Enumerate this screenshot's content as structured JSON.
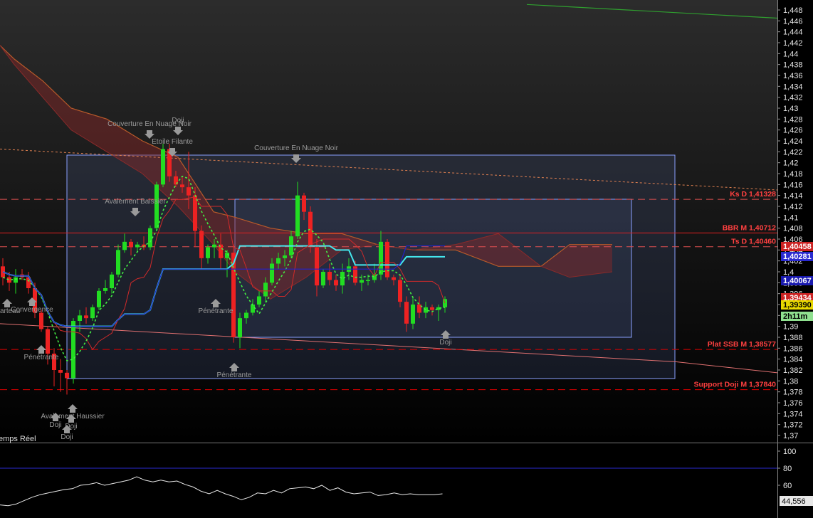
{
  "chart_data": [
    {
      "type": "candlestick",
      "title": "",
      "ylim": [
        1.369,
        1.449
      ],
      "y_ticks": [
        "1,448",
        "1,446",
        "1,444",
        "1,442",
        "1,44",
        "1,438",
        "1,436",
        "1,434",
        "1,432",
        "1,43",
        "1,428",
        "1,426",
        "1,424",
        "1,422",
        "1,42",
        "1,418",
        "1,416",
        "1,414",
        "1,412",
        "1,41",
        "1,408",
        "1,406",
        "1,404",
        "1,402",
        "1,4",
        "1,398",
        "1,396",
        "1,394",
        "1,392",
        "1,39",
        "1,388",
        "1,386",
        "1,384",
        "1,382",
        "1,38",
        "1,378",
        "1,376",
        "1,374",
        "1,372",
        "1,37"
      ],
      "y_tick_values": [
        1.448,
        1.446,
        1.444,
        1.442,
        1.44,
        1.438,
        1.436,
        1.434,
        1.432,
        1.43,
        1.428,
        1.426,
        1.424,
        1.422,
        1.42,
        1.418,
        1.416,
        1.414,
        1.412,
        1.41,
        1.408,
        1.406,
        1.404,
        1.402,
        1.4,
        1.398,
        1.396,
        1.394,
        1.392,
        1.39,
        1.388,
        1.386,
        1.384,
        1.382,
        1.38,
        1.378,
        1.376,
        1.374,
        1.372,
        1.37
      ],
      "candles": [
        [
          1.401,
          1.4025,
          1.3975,
          1.399
        ],
        [
          1.399,
          1.4,
          1.3965,
          1.398
        ],
        [
          1.398,
          1.4005,
          1.396,
          1.399
        ],
        [
          1.3995,
          1.4005,
          1.3985,
          1.399
        ],
        [
          1.399,
          1.4,
          1.396,
          1.397
        ],
        [
          1.397,
          1.398,
          1.3915,
          1.3925
        ],
        [
          1.3925,
          1.393,
          1.389,
          1.3895
        ],
        [
          1.3895,
          1.39,
          1.383,
          1.385
        ],
        [
          1.385,
          1.386,
          1.379,
          1.382
        ],
        [
          1.382,
          1.384,
          1.378,
          1.3815
        ],
        [
          1.3815,
          1.382,
          1.3775,
          1.3805
        ],
        [
          1.3805,
          1.3915,
          1.3795,
          1.391
        ],
        [
          1.391,
          1.393,
          1.389,
          1.392
        ],
        [
          1.392,
          1.3935,
          1.3905,
          1.3915
        ],
        [
          1.3915,
          1.394,
          1.391,
          1.3935
        ],
        [
          1.3935,
          1.397,
          1.393,
          1.3965
        ],
        [
          1.3965,
          1.3985,
          1.396,
          1.397
        ],
        [
          1.397,
          1.4,
          1.396,
          1.3995
        ],
        [
          1.3995,
          1.405,
          1.399,
          1.404
        ],
        [
          1.404,
          1.407,
          1.4035,
          1.4055
        ],
        [
          1.4055,
          1.406,
          1.403,
          1.4045
        ],
        [
          1.4045,
          1.4055,
          1.4035,
          1.405
        ],
        [
          1.405,
          1.4065,
          1.404,
          1.4045
        ],
        [
          1.4045,
          1.4085,
          1.404,
          1.408
        ],
        [
          1.408,
          1.4165,
          1.4075,
          1.416
        ],
        [
          1.416,
          1.4235,
          1.4155,
          1.4225
        ],
        [
          1.4225,
          1.4235,
          1.4165,
          1.4175
        ],
        [
          1.4175,
          1.4185,
          1.4155,
          1.416
        ],
        [
          1.416,
          1.4175,
          1.4145,
          1.4155
        ],
        [
          1.4155,
          1.422,
          1.4115,
          1.414
        ],
        [
          1.414,
          1.4155,
          1.4045,
          1.4075
        ],
        [
          1.4075,
          1.4085,
          1.4005,
          1.4025
        ],
        [
          1.4025,
          1.405,
          1.4015,
          1.4045
        ],
        [
          1.4045,
          1.406,
          1.4025,
          1.405
        ],
        [
          1.405,
          1.407,
          1.4005,
          1.4025
        ],
        [
          1.4025,
          1.404,
          1.399,
          1.4035
        ],
        [
          1.4035,
          1.405,
          1.387,
          1.388
        ],
        [
          1.388,
          1.3925,
          1.386,
          1.3915
        ],
        [
          1.3915,
          1.393,
          1.3905,
          1.3925
        ],
        [
          1.3925,
          1.395,
          1.392,
          1.394
        ],
        [
          1.394,
          1.3965,
          1.3935,
          1.3955
        ],
        [
          1.3955,
          1.399,
          1.3945,
          1.398
        ],
        [
          1.398,
          1.4025,
          1.3975,
          1.4015
        ],
        [
          1.4015,
          1.4035,
          1.4005,
          1.4025
        ],
        [
          1.4025,
          1.404,
          1.401,
          1.403
        ],
        [
          1.403,
          1.4075,
          1.4025,
          1.4065
        ],
        [
          1.4065,
          1.4165,
          1.406,
          1.414
        ],
        [
          1.414,
          1.4145,
          1.4095,
          1.411
        ],
        [
          1.411,
          1.412,
          1.4035,
          1.4045
        ],
        [
          1.4045,
          1.406,
          1.3955,
          1.3975
        ],
        [
          1.3975,
          1.4005,
          1.397,
          1.4
        ],
        [
          1.4,
          1.4015,
          1.3975,
          1.3985
        ],
        [
          1.3985,
          1.3995,
          1.3965,
          1.3975
        ],
        [
          1.3975,
          1.4015,
          1.396,
          1.4
        ],
        [
          1.4,
          1.4025,
          1.3985,
          1.401
        ],
        [
          1.401,
          1.402,
          1.3975,
          1.398
        ],
        [
          1.398,
          1.3995,
          1.3965,
          1.3985
        ],
        [
          1.3985,
          1.3995,
          1.3975,
          1.3985
        ],
        [
          1.3985,
          1.4015,
          1.398,
          1.3995
        ],
        [
          1.3995,
          1.4075,
          1.3985,
          1.4055
        ],
        [
          1.4055,
          1.406,
          1.3985,
          1.399
        ],
        [
          1.399,
          1.3995,
          1.3975,
          1.3985
        ],
        [
          1.3985,
          1.3995,
          1.3935,
          1.3945
        ],
        [
          1.3945,
          1.3955,
          1.389,
          1.3905
        ],
        [
          1.3905,
          1.3955,
          1.3895,
          1.394
        ],
        [
          1.394,
          1.3955,
          1.3915,
          1.3925
        ],
        [
          1.3925,
          1.3945,
          1.3915,
          1.3935
        ],
        [
          1.3935,
          1.394,
          1.392,
          1.393
        ],
        [
          1.393,
          1.394,
          1.391,
          1.3935
        ],
        [
          1.3935,
          1.3955,
          1.3925,
          1.395
        ]
      ],
      "lines": {
        "green_trend": [
          [
            740,
            1.449
          ],
          [
            1092,
            1.4465
          ]
        ],
        "orange_dotted": [
          [
            0,
            1.4225
          ],
          [
            1092,
            1.415
          ]
        ],
        "pink_support": [
          [
            0,
            1.3905
          ],
          [
            950,
            1.3835
          ],
          [
            1092,
            1.3815
          ]
        ]
      },
      "ichimoku_cloud": {
        "x": [
          0,
          20,
          60,
          100,
          150,
          200,
          250,
          300,
          330,
          380,
          430,
          480,
          530,
          580,
          640,
          700,
          760,
          800,
          860
        ],
        "span_a": [
          1.4415,
          1.439,
          1.435,
          1.43,
          1.428,
          1.424,
          1.421,
          1.411,
          1.41,
          1.408,
          1.407,
          1.407,
          1.405,
          1.404,
          1.404,
          1.401,
          1.401,
          1.405,
          1.405
        ],
        "span_b": [
          1.4415,
          1.438,
          1.432,
          1.426,
          1.422,
          1.418,
          1.412,
          1.405,
          1.4,
          1.395,
          1.399,
          1.404,
          1.405,
          1.404,
          1.405,
          1.407,
          1.401,
          1.399,
          1.4
        ]
      },
      "levels": [
        {
          "label": "Ks D 1,41328",
          "value": 1.41328,
          "color": "#e05050",
          "style": "dashed"
        },
        {
          "label": "BBR M 1,40712",
          "value": 1.40712,
          "color": "#e02020",
          "style": "solid"
        },
        {
          "label": "Ts D 1,40460",
          "value": 1.4046,
          "color": "#e05050",
          "style": "dashed"
        },
        {
          "label": "Plat SSB M 1,38577",
          "value": 1.38577,
          "color": "#e00000",
          "style": "dashed"
        },
        {
          "label": "Support  Doji M 1,37840",
          "value": 1.3784,
          "color": "#e00000",
          "style": "dashed"
        }
      ],
      "price_tags": [
        {
          "text": "1,40458",
          "bg": "#cc2222",
          "fg": "#ffffff"
        },
        {
          "text": "1,40281",
          "bg": "#2a2ad0",
          "fg": "#ffffff"
        },
        {
          "text": "1,40067",
          "bg": "#1a1ab0",
          "fg": "#ffffff"
        },
        {
          "text": "1,39434",
          "bg": "#cc2222",
          "fg": "#ffffff"
        },
        {
          "text": "1,39390",
          "bg": "#e8d800",
          "fg": "#000000"
        },
        {
          "text": "2h11m",
          "bg": "#8fe08f",
          "fg": "#000000"
        }
      ],
      "annotations": [
        {
          "text": "Couverture En Nuage Noir",
          "arrow": "down"
        },
        {
          "text": "Doji",
          "arrow": "down"
        },
        {
          "text": "Etoile Filante",
          "arrow": "down"
        },
        {
          "text": "Couverture En Nuage Noir",
          "arrow": "down"
        },
        {
          "text": "Avalement Baissier",
          "arrow": "down"
        },
        {
          "text": "Pénétrante",
          "arrow": "up"
        },
        {
          "text": "Pénétrante",
          "arrow": "up"
        },
        {
          "text": "Pénétrante",
          "arrow": "up"
        },
        {
          "text": "Doji",
          "arrow": "up"
        },
        {
          "text": "Doji",
          "arrow": "up"
        },
        {
          "text": "Marteau",
          "arrow": "up"
        },
        {
          "text": "Convergence",
          "arrow": "up"
        },
        {
          "text": "Avalement Haussier",
          "arrow": "up"
        },
        {
          "text": "Doji",
          "arrow": "up"
        },
        {
          "text": "Doji",
          "arrow": "up"
        }
      ],
      "mode_label": "emps Réel"
    },
    {
      "type": "line",
      "title": "",
      "ylim": [
        40,
        110
      ],
      "y_ticks": [
        "100",
        "80",
        "60"
      ],
      "y_tick_values": [
        100,
        80,
        60
      ],
      "reference_line": 80,
      "last_value": "44,556",
      "values": [
        37,
        36,
        38,
        42,
        46,
        49,
        51,
        53,
        55,
        56,
        60,
        61,
        63,
        60,
        62,
        64,
        66,
        70,
        66,
        64,
        66,
        64,
        65,
        61,
        58,
        53,
        50,
        54,
        50,
        47,
        43,
        46,
        51,
        50,
        54,
        51,
        56,
        57,
        58,
        56,
        60,
        54,
        57,
        52,
        50,
        51,
        52,
        48,
        49,
        51,
        49,
        50,
        49,
        49,
        49,
        50
      ]
    }
  ]
}
